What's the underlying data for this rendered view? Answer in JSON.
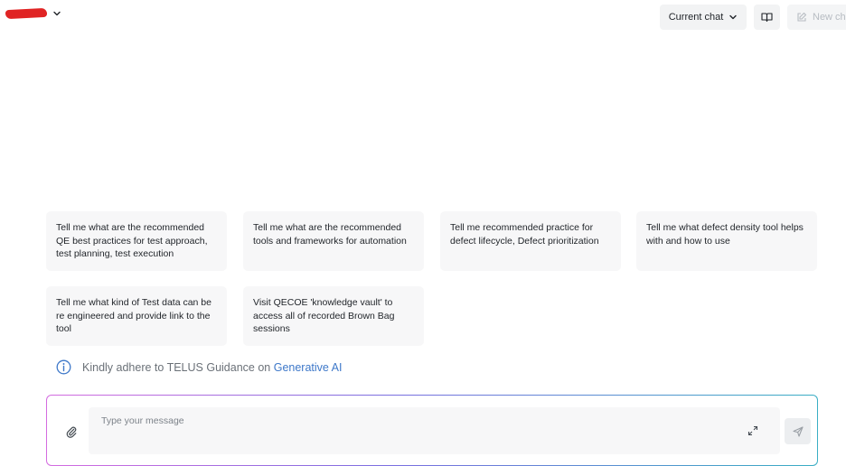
{
  "header": {
    "current_chat_label": "Current chat",
    "new_chat_label": "New chat"
  },
  "suggestions": [
    "Tell me what are the recommended QE best practices for test approach, test planning, test execution",
    "Tell me what are the recommended tools and frameworks for automation",
    "Tell me recommended practice for defect lifecycle, Defect prioritization",
    "Tell me what defect density tool helps with and how to use",
    "Tell me what kind of Test data can be re engineered and provide link to the tool",
    "Visit QECOE 'knowledge vault' to access all of recorded Brown Bag sessions"
  ],
  "guidance": {
    "text": "Kindly adhere to TELUS Guidance on",
    "link": "Generative AI"
  },
  "composer": {
    "placeholder": "Type your message",
    "value": ""
  },
  "icons": {
    "user_menu_chevron": "chevron-down-icon",
    "current_chat_chevron": "chevron-down-icon",
    "book": "book-icon",
    "new_chat": "edit-icon",
    "info": "info-icon",
    "attach": "paperclip-icon",
    "expand": "expand-icon",
    "send": "send-icon"
  },
  "colors": {
    "redaction": "#e02424",
    "link": "#3e78c9",
    "card_bg": "#f7f7f8",
    "gradient_start": "#d46ce0",
    "gradient_end": "#3aaec4"
  }
}
